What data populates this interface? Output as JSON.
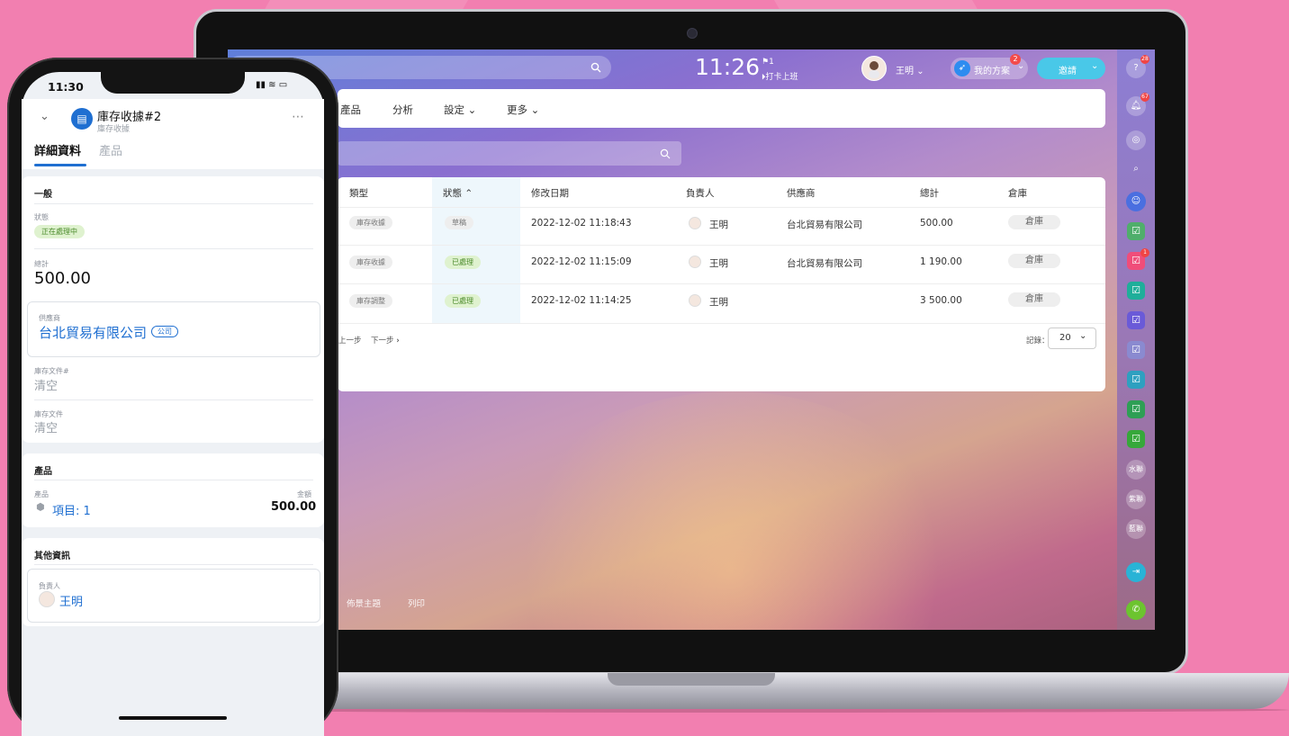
{
  "laptop": {
    "clock": "11:26",
    "flag_count": "1",
    "punch_label": "打卡上班",
    "user_name": "王明",
    "plan_label": "我的方案",
    "plan_badge": "2",
    "invite_label": "邀請",
    "nav": [
      "產品",
      "分析",
      "設定",
      "更多"
    ],
    "table": {
      "headers": [
        "類型",
        "狀態",
        "修改日期",
        "負責人",
        "供應商",
        "總計",
        "倉庫"
      ],
      "rows": [
        {
          "type": "庫存收據",
          "status": "草稿",
          "date": "2022-12-02 11:18:43",
          "owner": "王明",
          "supplier": "台北貿易有限公司",
          "total": "500.00",
          "warehouse": "倉庫"
        },
        {
          "type": "庫存收據",
          "status": "已處理",
          "date": "2022-12-02 11:15:09",
          "owner": "王明",
          "supplier": "台北貿易有限公司",
          "total": "1 190.00",
          "warehouse": "倉庫"
        },
        {
          "type": "庫存調整",
          "status": "已處理",
          "date": "2022-12-02 11:14:25",
          "owner": "王明",
          "supplier": "",
          "total": "3 500.00",
          "warehouse": "倉庫"
        }
      ]
    },
    "pager": {
      "prev": "上一步",
      "next": "下一步",
      "records_label": "記錄：",
      "records_value": "20"
    },
    "footer": [
      "佈景主題",
      "列印"
    ],
    "sidebar": {
      "help_badge": "28",
      "bell_badge": "67",
      "task_badge": "1",
      "chats": [
        "水聯",
        "紫聯",
        "藍聯"
      ]
    }
  },
  "phone": {
    "time": "11:30",
    "title": "庫存收據#2",
    "subtitle": "庫存收據",
    "tabs": [
      "詳細資料",
      "產品"
    ],
    "general": {
      "section": "一般",
      "status_label": "狀態",
      "status_value": "正在處理中",
      "total_label": "總計",
      "total_value": "500.00",
      "supplier_label": "供應商",
      "supplier_value": "台北貿易有限公司",
      "supplier_tag": "公司",
      "doc_no_label": "庫存文件#",
      "doc_no_value": "清空",
      "doc_label": "庫存文件",
      "doc_value": "清空"
    },
    "products": {
      "section": "產品",
      "product_label": "產品",
      "amount_label": "金額",
      "item_value": "項目: 1",
      "amount_value": "500.00"
    },
    "other": {
      "section": "其他資訊",
      "owner_label": "負責人",
      "owner_value": "王明"
    }
  },
  "colors": {
    "background": "#f27fb0",
    "accent": "#1f6fd1",
    "invite": "#49c8e8",
    "badge": "#f04545"
  }
}
